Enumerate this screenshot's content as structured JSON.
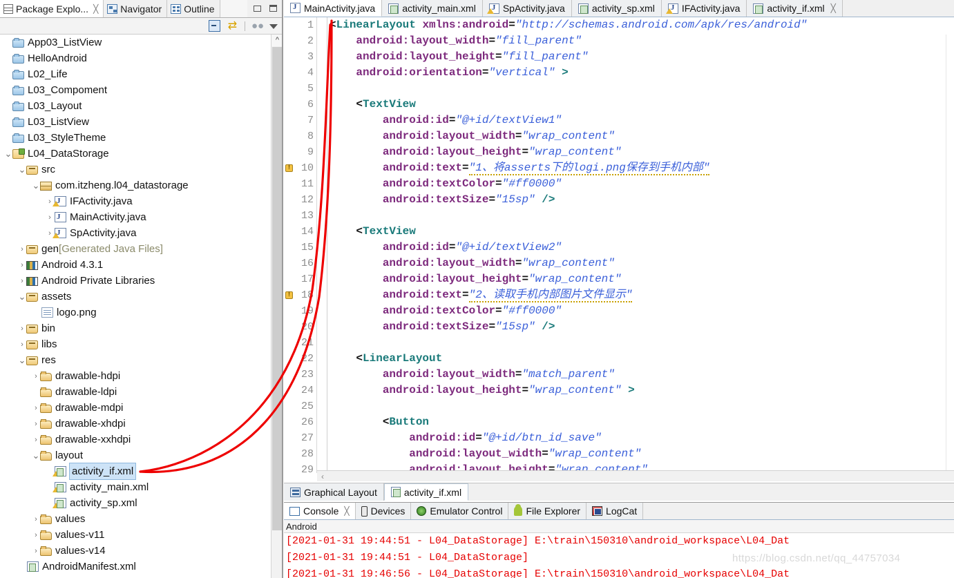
{
  "left_panel": {
    "tabs": [
      {
        "label": "Package Explo...",
        "icon": "package-explorer-icon",
        "active": true,
        "closable": true
      },
      {
        "label": "Navigator",
        "icon": "navigator-icon",
        "active": false,
        "closable": false
      },
      {
        "label": "Outline",
        "icon": "outline-icon",
        "active": false,
        "closable": false
      }
    ],
    "window_buttons": [
      "minimize",
      "maximize"
    ],
    "toolbar": {
      "collapse_all": "collapse-all-icon",
      "link_with_editor": "link-with-editor-icon",
      "focus_on_active_task": "focus-task-icon",
      "view_menu": "view-menu-icon"
    },
    "tree": [
      {
        "label": "App03_ListView",
        "indent": 0,
        "arrow": "",
        "icon": "folder-closed-icon"
      },
      {
        "label": "HelloAndroid",
        "indent": 0,
        "arrow": "",
        "icon": "folder-closed-icon"
      },
      {
        "label": "L02_Life",
        "indent": 0,
        "arrow": "",
        "icon": "folder-closed-icon"
      },
      {
        "label": "L03_Compoment",
        "indent": 0,
        "arrow": "",
        "icon": "folder-closed-icon"
      },
      {
        "label": "L03_Layout",
        "indent": 0,
        "arrow": "",
        "icon": "folder-closed-icon"
      },
      {
        "label": "L03_ListView",
        "indent": 0,
        "arrow": "",
        "icon": "folder-closed-icon"
      },
      {
        "label": "L03_StyleTheme",
        "indent": 0,
        "arrow": "",
        "icon": "folder-closed-icon"
      },
      {
        "label": "L04_DataStorage",
        "indent": 0,
        "arrow": "v",
        "icon": "android-project-icon"
      },
      {
        "label": "src",
        "indent": 1,
        "arrow": "v",
        "icon": "source-folder-icon"
      },
      {
        "label": "com.itzheng.l04_datastorage",
        "indent": 2,
        "arrow": "v",
        "icon": "package-icon"
      },
      {
        "label": "IFActivity.java",
        "indent": 3,
        "arrow": ">",
        "icon": "java-file-warning-icon"
      },
      {
        "label": "MainActivity.java",
        "indent": 3,
        "arrow": ">",
        "icon": "java-file-icon"
      },
      {
        "label": "SpActivity.java",
        "indent": 3,
        "arrow": ">",
        "icon": "java-file-warning-icon"
      },
      {
        "label": "gen",
        "suffix": " [Generated Java Files]",
        "indent": 1,
        "arrow": ">",
        "icon": "source-folder-icon"
      },
      {
        "label": "Android 4.3.1",
        "indent": 1,
        "arrow": ">",
        "icon": "library-icon"
      },
      {
        "label": "Android Private Libraries",
        "indent": 1,
        "arrow": ">",
        "icon": "library-icon"
      },
      {
        "label": "assets",
        "indent": 1,
        "arrow": "v",
        "icon": "folder-icon"
      },
      {
        "label": "logo.png",
        "indent": 2,
        "arrow": "",
        "icon": "file-icon"
      },
      {
        "label": "bin",
        "indent": 1,
        "arrow": ">",
        "icon": "folder-icon"
      },
      {
        "label": "libs",
        "indent": 1,
        "arrow": ">",
        "icon": "folder-icon"
      },
      {
        "label": "res",
        "indent": 1,
        "arrow": "v",
        "icon": "folder-icon"
      },
      {
        "label": "drawable-hdpi",
        "indent": 2,
        "arrow": ">",
        "icon": "res-folder-icon"
      },
      {
        "label": "drawable-ldpi",
        "indent": 2,
        "arrow": "",
        "icon": "res-folder-icon"
      },
      {
        "label": "drawable-mdpi",
        "indent": 2,
        "arrow": ">",
        "icon": "res-folder-icon"
      },
      {
        "label": "drawable-xhdpi",
        "indent": 2,
        "arrow": ">",
        "icon": "res-folder-icon"
      },
      {
        "label": "drawable-xxhdpi",
        "indent": 2,
        "arrow": ">",
        "icon": "res-folder-icon"
      },
      {
        "label": "layout",
        "indent": 2,
        "arrow": "v",
        "icon": "res-folder-icon"
      },
      {
        "label": "activity_if.xml",
        "indent": 3,
        "arrow": "",
        "icon": "xml-file-warning-icon",
        "selected": true
      },
      {
        "label": "activity_main.xml",
        "indent": 3,
        "arrow": "",
        "icon": "xml-file-warning-icon"
      },
      {
        "label": "activity_sp.xml",
        "indent": 3,
        "arrow": "",
        "icon": "xml-file-warning-icon"
      },
      {
        "label": "values",
        "indent": 2,
        "arrow": ">",
        "icon": "res-folder-icon"
      },
      {
        "label": "values-v11",
        "indent": 2,
        "arrow": ">",
        "icon": "res-folder-icon"
      },
      {
        "label": "values-v14",
        "indent": 2,
        "arrow": ">",
        "icon": "res-folder-icon"
      },
      {
        "label": "AndroidManifest.xml",
        "indent": 1,
        "arrow": "",
        "icon": "xml-file-icon"
      }
    ]
  },
  "editor": {
    "tabs": [
      {
        "label": "MainActivity.java",
        "icon": "java-file-icon",
        "active": true,
        "closable": false
      },
      {
        "label": "activity_main.xml",
        "icon": "xml-file-icon",
        "active": false,
        "closable": false
      },
      {
        "label": "SpActivity.java",
        "icon": "java-file-warning-icon",
        "active": false,
        "closable": false
      },
      {
        "label": "activity_sp.xml",
        "icon": "xml-file-icon",
        "active": false,
        "closable": false
      },
      {
        "label": "IFActivity.java",
        "icon": "java-file-warning-icon",
        "active": false,
        "closable": false
      },
      {
        "label": "activity_if.xml",
        "icon": "xml-file-icon",
        "active": false,
        "closable": true
      }
    ],
    "code_lines": [
      {
        "n": 1,
        "warn": false,
        "html": "<span class='k-punc'>&lt;</span><span class='k-tag'>LinearLayout</span> <span class='k-attr'>xmlns:android</span><span class='k-punc'>=</span><span class='k-str'>\"http://schemas.android.com/apk/res/android\"</span>"
      },
      {
        "n": 2,
        "warn": false,
        "html": "    <span class='k-attr'>android:layout_width</span><span class='k-punc'>=</span><span class='k-str'>\"fill_parent\"</span>"
      },
      {
        "n": 3,
        "warn": false,
        "html": "    <span class='k-attr'>android:layout_height</span><span class='k-punc'>=</span><span class='k-str'>\"fill_parent\"</span>"
      },
      {
        "n": 4,
        "warn": false,
        "html": "    <span class='k-attr'>android:orientation</span><span class='k-punc'>=</span><span class='k-str'>\"vertical\"</span> <span class='k-tag'>&gt;</span>"
      },
      {
        "n": 5,
        "warn": false,
        "html": ""
      },
      {
        "n": 6,
        "warn": false,
        "html": "    <span class='k-punc'>&lt;</span><span class='k-tag'>TextView</span>"
      },
      {
        "n": 7,
        "warn": false,
        "html": "        <span class='k-attr'>android:id</span><span class='k-punc'>=</span><span class='k-str'>\"@+id/textView1\"</span>"
      },
      {
        "n": 8,
        "warn": false,
        "html": "        <span class='k-attr'>android:layout_width</span><span class='k-punc'>=</span><span class='k-str'>\"wrap_content\"</span>"
      },
      {
        "n": 9,
        "warn": false,
        "html": "        <span class='k-attr'>android:layout_height</span><span class='k-punc'>=</span><span class='k-str'>\"wrap_content\"</span>"
      },
      {
        "n": 10,
        "warn": true,
        "html": "        <span class='k-attr'>android:text</span><span class='k-punc'>=</span><span class='k-str squig'>\"1、将asserts下的logi.png保存到手机内部\"</span>"
      },
      {
        "n": 11,
        "warn": false,
        "html": "        <span class='k-attr'>android:textColor</span><span class='k-punc'>=</span><span class='k-str'>\"#ff0000\"</span>"
      },
      {
        "n": 12,
        "warn": false,
        "html": "        <span class='k-attr'>android:textSize</span><span class='k-punc'>=</span><span class='k-str'>\"15sp\"</span> <span class='k-tag'>/&gt;</span>"
      },
      {
        "n": 13,
        "warn": false,
        "html": ""
      },
      {
        "n": 14,
        "warn": false,
        "html": "    <span class='k-punc'>&lt;</span><span class='k-tag'>TextView</span>"
      },
      {
        "n": 15,
        "warn": false,
        "html": "        <span class='k-attr'>android:id</span><span class='k-punc'>=</span><span class='k-str'>\"@+id/textView2\"</span>"
      },
      {
        "n": 16,
        "warn": false,
        "html": "        <span class='k-attr'>android:layout_width</span><span class='k-punc'>=</span><span class='k-str'>\"wrap_content\"</span>"
      },
      {
        "n": 17,
        "warn": false,
        "html": "        <span class='k-attr'>android:layout_height</span><span class='k-punc'>=</span><span class='k-str'>\"wrap_content\"</span>"
      },
      {
        "n": 18,
        "warn": true,
        "html": "        <span class='k-attr'>android:text</span><span class='k-punc'>=</span><span class='k-str squig'>\"2、读取手机内部图片文件显示\"</span>"
      },
      {
        "n": 19,
        "warn": false,
        "html": "        <span class='k-attr'>android:textColor</span><span class='k-punc'>=</span><span class='k-str'>\"#ff0000\"</span>"
      },
      {
        "n": 20,
        "warn": false,
        "html": "        <span class='k-attr'>android:textSize</span><span class='k-punc'>=</span><span class='k-str'>\"15sp\"</span> <span class='k-tag'>/&gt;</span>"
      },
      {
        "n": 21,
        "warn": false,
        "html": ""
      },
      {
        "n": 22,
        "warn": false,
        "html": "    <span class='k-punc'>&lt;</span><span class='k-tag'>LinearLayout</span>"
      },
      {
        "n": 23,
        "warn": false,
        "html": "        <span class='k-attr'>android:layout_width</span><span class='k-punc'>=</span><span class='k-str'>\"match_parent\"</span>"
      },
      {
        "n": 24,
        "warn": false,
        "html": "        <span class='k-attr'>android:layout_height</span><span class='k-punc'>=</span><span class='k-str'>\"wrap_content\"</span> <span class='k-tag'>&gt;</span>"
      },
      {
        "n": 25,
        "warn": false,
        "html": ""
      },
      {
        "n": 26,
        "warn": false,
        "html": "        <span class='k-punc'>&lt;</span><span class='k-tag'>Button</span>"
      },
      {
        "n": 27,
        "warn": false,
        "html": "            <span class='k-attr'>android:id</span><span class='k-punc'>=</span><span class='k-str'>\"@+id/btn_id_save\"</span>"
      },
      {
        "n": 28,
        "warn": false,
        "html": "            <span class='k-attr'>android:layout_width</span><span class='k-punc'>=</span><span class='k-str'>\"wrap_content\"</span>"
      },
      {
        "n": 29,
        "warn": false,
        "html": "            <span class='k-attr'>android:layout_height</span><span class='k-punc'>=</span><span class='k-str'>\"wrap_content\"</span>"
      }
    ],
    "hscroll_left_arrow": "‹"
  },
  "layout_tabs": [
    {
      "label": "Graphical Layout",
      "icon": "graphical-layout-icon",
      "active": false
    },
    {
      "label": "activity_if.xml",
      "icon": "xml-source-icon",
      "active": true
    }
  ],
  "bottom_view": {
    "tabs": [
      {
        "label": "Console",
        "icon": "console-icon",
        "active": true,
        "closable": true
      },
      {
        "label": "Devices",
        "icon": "devices-icon",
        "active": false,
        "closable": false
      },
      {
        "label": "Emulator Control",
        "icon": "emulator-icon",
        "active": false,
        "closable": false
      },
      {
        "label": "File Explorer",
        "icon": "file-explorer-icon",
        "active": false,
        "closable": false
      },
      {
        "label": "LogCat",
        "icon": "logcat-icon",
        "active": false,
        "closable": false
      }
    ],
    "console_title": "Android",
    "console_lines": [
      "[2021-01-31 19:44:51 - L04_DataStorage] E:\\train\\150310\\android_workspace\\L04_Dat",
      "[2021-01-31 19:44:51 - L04_DataStorage]",
      "[2021-01-31 19:46:56 - L04_DataStorage] E:\\train\\150310\\android_workspace\\L04_Dat"
    ],
    "console_text_color": "#e60000"
  },
  "annotation": {
    "color": "#ee0000",
    "description": "red-curve-from-activity_if.xml-to-editor"
  },
  "watermark": "https://blog.csdn.net/qq_44757034"
}
